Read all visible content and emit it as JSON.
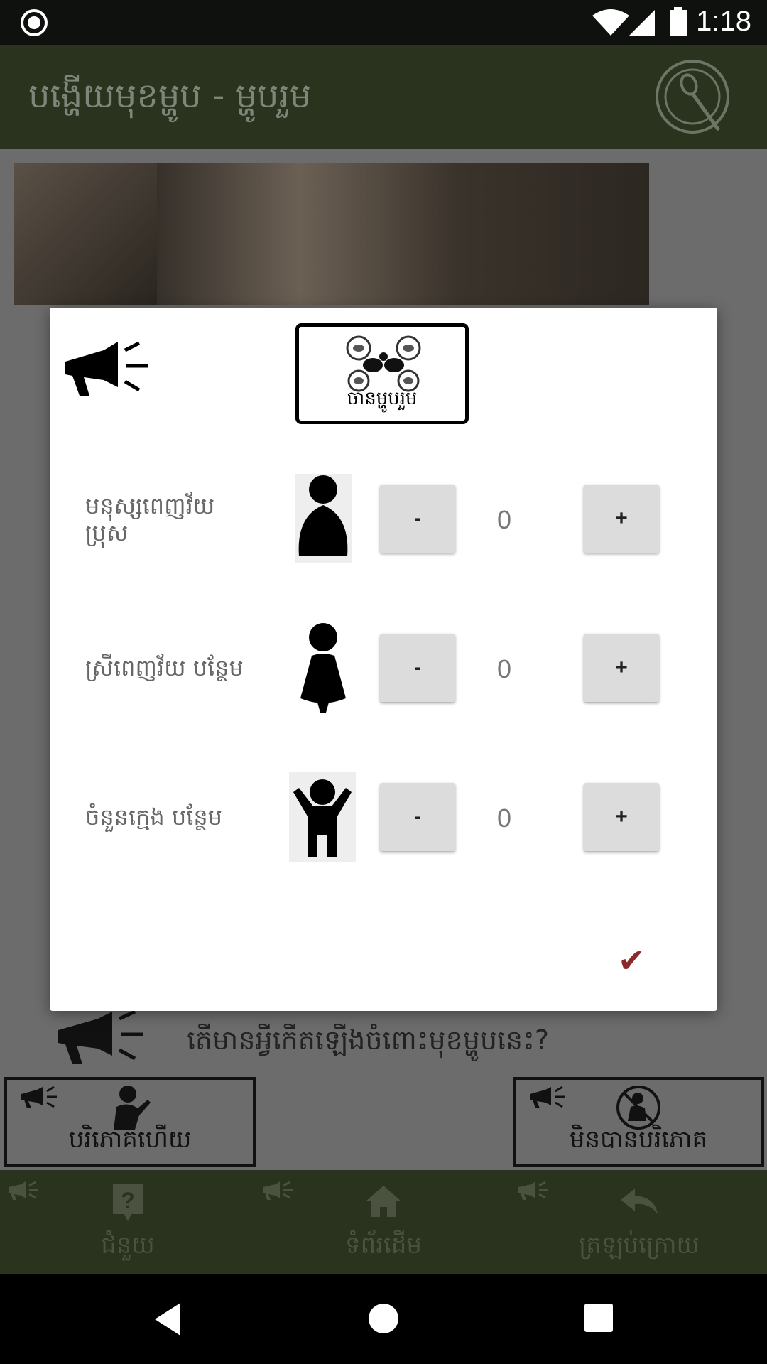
{
  "status_bar": {
    "time": "1:18"
  },
  "app_bar": {
    "title": "បង្ហើយមុខម្ហូប - ម្ហូបរួម"
  },
  "main": {
    "question": "តើមានអ្វីកើតឡើងចំពោះមុខម្ហូបនេះ?",
    "choices": [
      {
        "label": "បរិភោគហើយ"
      },
      {
        "label": "មិនបានបរិភោគ"
      }
    ]
  },
  "bottom_nav": {
    "items": [
      {
        "label": "ជំនួយ",
        "icon": "help-icon"
      },
      {
        "label": "ទំព័រដើម",
        "icon": "home-icon"
      },
      {
        "label": "ត្រឡប់ក្រោយ",
        "icon": "back-arrow-icon"
      }
    ]
  },
  "dialog": {
    "meal_button": {
      "label": "ចានម្ហូបរួម"
    },
    "rows": [
      {
        "label": "មនុស្សពេញវ័យ ប្រុស",
        "minus": "-",
        "count": "0",
        "plus": "+",
        "icon": "adult-male-icon"
      },
      {
        "label": "ស្រីពេញវ័យ បន្ថែម",
        "minus": "-",
        "count": "0",
        "plus": "+",
        "icon": "adult-female-icon"
      },
      {
        "label": "ចំនួនក្មេង បន្ថែម",
        "minus": "-",
        "count": "0",
        "plus": "+",
        "icon": "child-icon"
      }
    ],
    "confirm": "✔"
  },
  "colors": {
    "app_bar": "#29331d",
    "overlay": "#6c6c6c",
    "confirm": "#8b2a2a"
  }
}
